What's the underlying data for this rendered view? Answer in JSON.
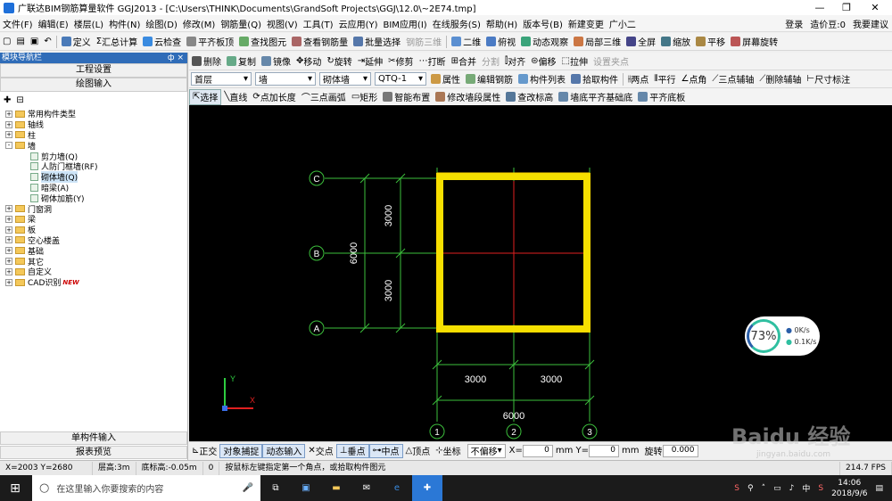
{
  "title": "广联达BIM钢筋算量软件 GGJ2013 - [C:\\Users\\THINK\\Documents\\GrandSoft Projects\\GGJ\\12.0\\~2E74.tmp]",
  "menu": [
    "文件(F)",
    "编辑(E)",
    "楼层(L)",
    "构件(N)",
    "绘图(D)",
    "修改(M)",
    "钢筋量(Q)",
    "视图(V)",
    "工具(T)",
    "云应用(Y)",
    "BIM应用(I)",
    "在线服务(S)",
    "帮助(H)",
    "版本号(B)",
    "新建变更",
    "广小二"
  ],
  "menu_right": {
    "login": "登录",
    "cost": "造价豆:0",
    "suggest": "我要建议"
  },
  "toolbar1": [
    "定义",
    "汇总计算",
    "云检查",
    "平齐板顶",
    "查找图元",
    "查看钢筋量",
    "批量选择",
    "钢筋三维",
    "二维",
    "俯视",
    "动态观察",
    "局部三维",
    "全屏",
    "缩放",
    "平移",
    "屏幕旋转"
  ],
  "toolbar2": [
    "删除",
    "复制",
    "镜像",
    "移动",
    "旋转",
    "延伸",
    "修剪",
    "打断",
    "合并",
    "分割",
    "对齐",
    "偏移",
    "拉伸",
    "设置夹点"
  ],
  "toolbar3": {
    "floor": "首层",
    "type": "墙",
    "sub": "砌体墙",
    "code": "QTQ-1",
    "buttons": [
      "属性",
      "编辑钢筋",
      "构件列表",
      "拾取构件",
      "两点",
      "平行",
      "点角",
      "三点辅轴",
      "删除辅轴",
      "尺寸标注"
    ]
  },
  "toolbar4": [
    "选择",
    "直线",
    "点加长度",
    "三点画弧",
    "矩形",
    "智能布置",
    "修改墙段属性",
    "查改标高",
    "墙底平齐基础底",
    "平齐底板"
  ],
  "panel": {
    "header": "模块导航栏",
    "pin": "ф ×",
    "btn_settings": "工程设置",
    "btn_drawing": "绘图输入",
    "tree": [
      {
        "label": "常用构件类型",
        "level": 0,
        "kind": "folder",
        "exp": "+"
      },
      {
        "label": "轴线",
        "level": 0,
        "kind": "folder",
        "exp": "+"
      },
      {
        "label": "柱",
        "level": 0,
        "kind": "folder",
        "exp": "+"
      },
      {
        "label": "墙",
        "level": 0,
        "kind": "folder",
        "exp": "-"
      },
      {
        "label": "剪力墙(Q)",
        "level": 1,
        "kind": "leaf"
      },
      {
        "label": "人防门框墙(RF)",
        "level": 1,
        "kind": "leaf"
      },
      {
        "label": "砌体墙(Q)",
        "level": 1,
        "kind": "leaf",
        "selected": true
      },
      {
        "label": "暗梁(A)",
        "level": 1,
        "kind": "leaf"
      },
      {
        "label": "砌体加筋(Y)",
        "level": 1,
        "kind": "leaf"
      },
      {
        "label": "门窗洞",
        "level": 0,
        "kind": "folder",
        "exp": "+"
      },
      {
        "label": "梁",
        "level": 0,
        "kind": "folder",
        "exp": "+"
      },
      {
        "label": "板",
        "level": 0,
        "kind": "folder",
        "exp": "+"
      },
      {
        "label": "空心楼盖",
        "level": 0,
        "kind": "folder",
        "exp": "+"
      },
      {
        "label": "基础",
        "level": 0,
        "kind": "folder",
        "exp": "+"
      },
      {
        "label": "其它",
        "level": 0,
        "kind": "folder",
        "exp": "+"
      },
      {
        "label": "自定义",
        "level": 0,
        "kind": "folder",
        "exp": "+"
      },
      {
        "label": "CAD识别",
        "level": 0,
        "kind": "folder",
        "exp": "+",
        "badge": "NEW"
      }
    ],
    "btn_single": "单构件输入",
    "btn_report": "报表预览"
  },
  "drawing": {
    "axes_h": [
      "C",
      "B",
      "A"
    ],
    "axes_v": [
      "1",
      "2",
      "3"
    ],
    "dim_left_total": "6000",
    "dim_left_parts": [
      "3000",
      "3000"
    ],
    "dim_bottom_parts": [
      "3000",
      "3000"
    ],
    "dim_bottom_total": "6000",
    "ucs_x": "X",
    "ucs_y": "Y"
  },
  "network": {
    "percent": "73%",
    "up": "0K/s",
    "down": "0.1K/s"
  },
  "snapbar": {
    "items": [
      "正交",
      "对象捕捉",
      "动态输入",
      "交点",
      "垂点",
      "中点",
      "顶点",
      "坐标",
      "不偏移"
    ],
    "x_label": "X=",
    "x_val": "0",
    "y_label": "mm Y=",
    "y_val": "0",
    "mm": "mm",
    "rotate": "旋转",
    "rot_val": "0.000"
  },
  "status": {
    "coords": "X=2003 Y=2680",
    "floor_h": "层高:3m",
    "base_h": "底标高:-0.05m",
    "zero": "0",
    "hint": "按鼠标左键指定第一个角点，或拾取构件图元",
    "fps": "214.7 FPS"
  },
  "taskbar": {
    "search": "在这里输入你要搜索的内容",
    "ime": "中",
    "time": "14:06",
    "date": "2018/9/6"
  },
  "watermark": {
    "text": "Baidu 经验",
    "url": "jingyan.baidu.com"
  }
}
